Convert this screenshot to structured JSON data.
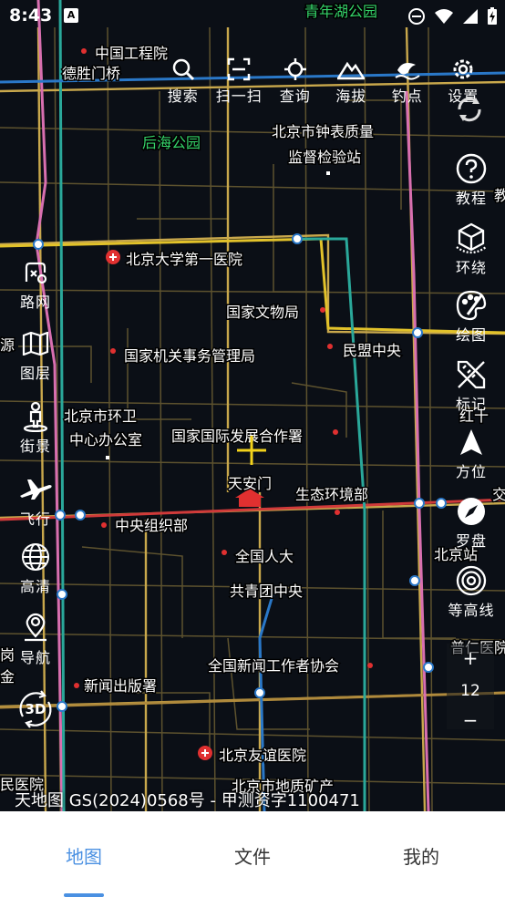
{
  "status_bar": {
    "time": "8:43",
    "icons": [
      "notification-a-icon",
      "do-not-disturb-icon",
      "wifi-icon",
      "signal-icon",
      "battery-charging-icon"
    ]
  },
  "top_toolbar": [
    {
      "label": "搜索",
      "icon": "search-icon"
    },
    {
      "label": "扫一扫",
      "icon": "scan-icon"
    },
    {
      "label": "查询",
      "icon": "locate-query-icon"
    },
    {
      "label": "海拔",
      "icon": "mountain-icon"
    },
    {
      "label": "钓点",
      "icon": "fishing-icon"
    },
    {
      "label": "设置",
      "icon": "gear-icon"
    }
  ],
  "left_toolbar": [
    {
      "label": "路网",
      "icon": "road-network-icon"
    },
    {
      "label": "图层",
      "icon": "layers-icon"
    },
    {
      "label": "街景",
      "icon": "street-view-icon"
    },
    {
      "label": "飞行",
      "icon": "airplane-icon"
    },
    {
      "label": "高清",
      "icon": "globe-icon"
    },
    {
      "label": "导航",
      "icon": "navigation-pin-icon"
    },
    {
      "label": "3D",
      "icon": "rotate-3d-icon"
    }
  ],
  "right_toolbar": [
    {
      "label": "教程",
      "icon": "help-icon"
    },
    {
      "label": "环绕",
      "icon": "cube-icon"
    },
    {
      "label": "绘图",
      "icon": "palette-icon"
    },
    {
      "label": "标记",
      "icon": "ruler-pencil-icon"
    },
    {
      "label": "方位",
      "icon": "arrow-up-icon"
    },
    {
      "label": "罗盘",
      "icon": "compass-icon"
    },
    {
      "label": "等高线",
      "icon": "contour-icon"
    }
  ],
  "zoom": {
    "plus": "+",
    "level": "12",
    "minus": "−"
  },
  "map_labels": {
    "places": [
      "中国工程院",
      "德胜门桥",
      "青年湖公园",
      "后海公园",
      "北京市钟表质量",
      "监督检验站",
      "北京大学第一医院",
      "国家文物局",
      "国家机关事务管理局",
      "民盟中央",
      "北京市环卫",
      "中心办公室",
      "国家国际发展合作署",
      "天安门",
      "生态环境部",
      "中央组织部",
      "全国人大",
      "共青团中央",
      "全国新闻工作者协会",
      "新闻出版署",
      "北京友谊医院",
      "北京市地质矿产",
      "民医院",
      "北京站",
      "普仁医院",
      "红十",
      "交",
      "源",
      "岗",
      "金",
      "局",
      "教"
    ]
  },
  "copyright": "天地图 GS(2024)0568号 - 甲测资字1100471",
  "bottom_nav": [
    {
      "label": "地图",
      "active": true
    },
    {
      "label": "文件",
      "active": false
    },
    {
      "label": "我的",
      "active": false
    }
  ],
  "colors": {
    "accent": "#4a90e2",
    "road_major": "#c9a84c",
    "road_minor": "#8a7a45",
    "subway_teal": "#2aa89a",
    "subway_pink": "#d86fb0",
    "subway_blue": "#2a78c8",
    "subway_yellow": "#e2c22a",
    "subway_red": "#d03a3a",
    "crosshair": "#f2d21b"
  }
}
